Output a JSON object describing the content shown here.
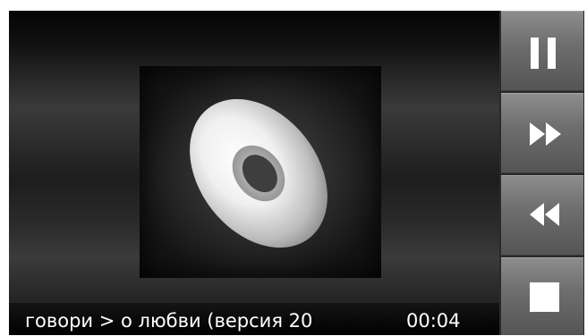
{
  "player": {
    "track_title": "говори > о любви (версия 20",
    "elapsed_time": "00:04"
  },
  "controls": {
    "pause": "pause",
    "fast_forward": "fast-forward",
    "rewind": "rewind",
    "stop": "stop"
  },
  "colors": {
    "frame_background": "#000000",
    "button_light": "#8d8d8d",
    "button_dark": "#545454",
    "icon": "#ffffff",
    "text": "#ffffff"
  }
}
